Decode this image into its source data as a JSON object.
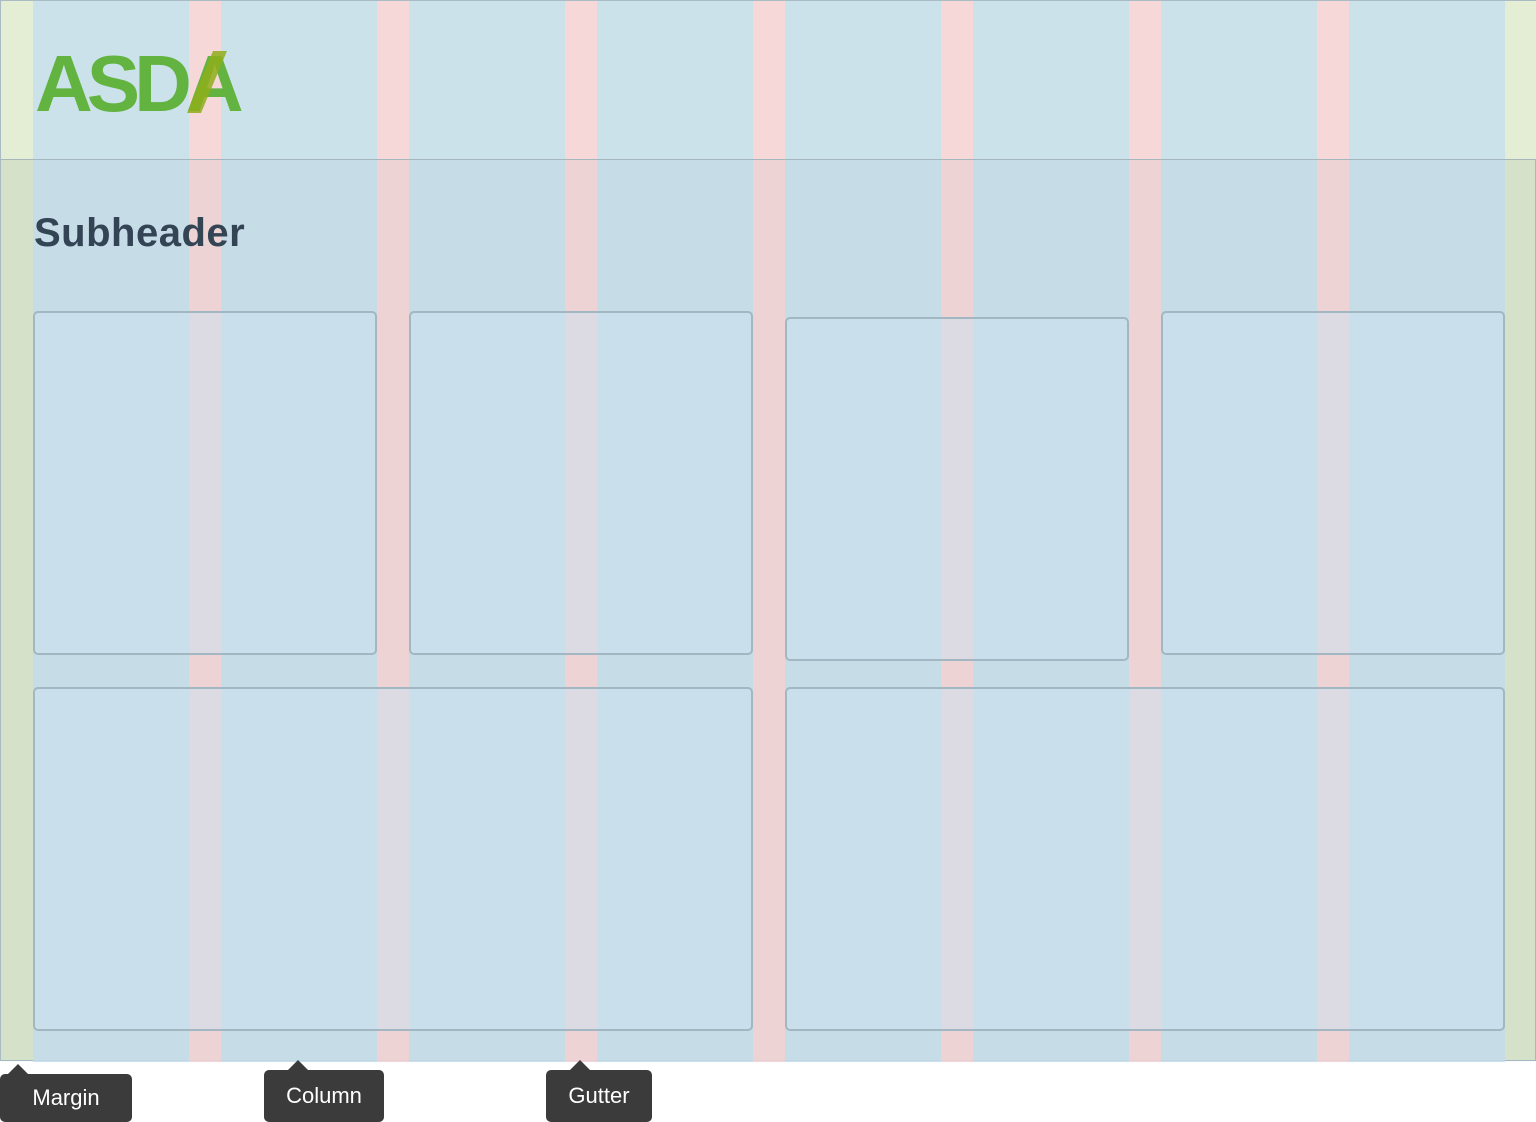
{
  "logo": {
    "text": "ASDA",
    "color": "#62b33f",
    "slash_color": "#8fae1b"
  },
  "subheader": "Subheader",
  "legend": {
    "margin_label": "Margin",
    "column_label": "Column",
    "gutter_label": "Gutter"
  },
  "colors": {
    "margin": "#dbe6cb",
    "column": "#cce2f0",
    "gutter": "#f6d6d8",
    "card_border": "#a3b7c2",
    "label_bg": "#3b3b3b"
  }
}
